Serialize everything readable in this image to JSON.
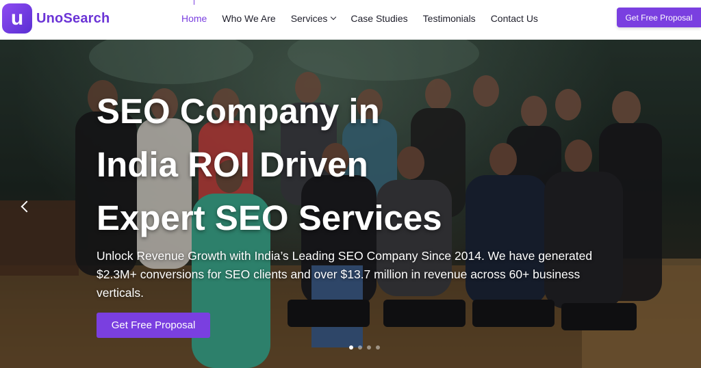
{
  "brand": {
    "logo_letter": "u",
    "name": "UnoSearch",
    "accent": "#7a3fe0"
  },
  "nav": {
    "items": [
      {
        "label": "Home",
        "active": true
      },
      {
        "label": "Who We Are"
      },
      {
        "label": "Services",
        "has_dropdown": true
      },
      {
        "label": "Case Studies"
      },
      {
        "label": "Testimonials"
      },
      {
        "label": "Contact Us"
      }
    ],
    "cta": "Get Free Proposal"
  },
  "hero": {
    "title_lines": [
      "SEO Company in",
      "India ROI Driven",
      "Expert SEO Services"
    ],
    "subtitle": "Unlock Revenue Growth with India’s Leading SEO Company Since 2014. We have generated $2.3M+ conversions for SEO clients and over $13.7 million in revenue across 60+ business verticals.",
    "cta": "Get Free Proposal",
    "background": "team-group-photo",
    "slides_total": 4,
    "active_slide": 1
  },
  "icons": {
    "prev": "chevron-left-icon",
    "dropdown": "chevron-down-icon"
  }
}
